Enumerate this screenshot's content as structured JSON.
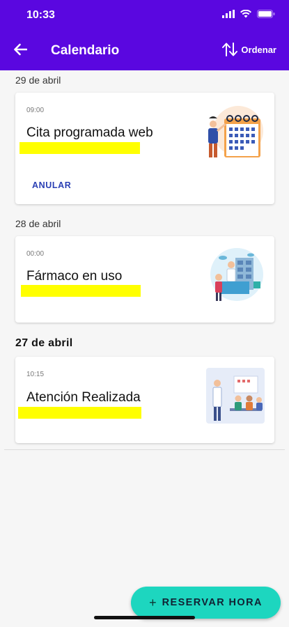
{
  "status": {
    "time": "10:33"
  },
  "appbar": {
    "title": "Calendario",
    "order_label": "Ordenar"
  },
  "sections": [
    {
      "date": "29 de abril",
      "time": "09:00",
      "title": "Cita programada web",
      "action": "ANULAR"
    },
    {
      "date": "28 de abril",
      "time": "00:00",
      "title": "Fármaco en uso"
    },
    {
      "date": "27 de abril",
      "time": "10:15",
      "title": "Atención Realizada"
    }
  ],
  "fab": {
    "label": "RESERVAR HORA"
  },
  "colors": {
    "header": "#5a07e0",
    "fab": "#1dd6bf",
    "highlight": "#ffff00",
    "link": "#2a3fb4"
  }
}
